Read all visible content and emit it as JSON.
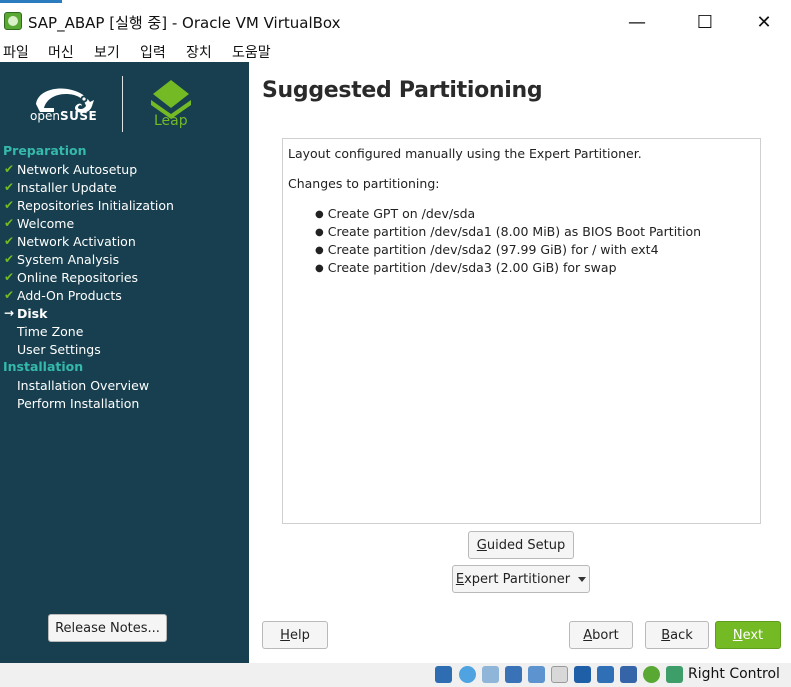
{
  "window": {
    "title": "SAP_ABAP [실행 중] - Oracle VM VirtualBox",
    "minimize_glyph": "—",
    "maximize_glyph": "☐",
    "close_glyph": "✕"
  },
  "menubar": {
    "items": [
      "파일",
      "머신",
      "보기",
      "입력",
      "장치",
      "도움말"
    ]
  },
  "sidebar": {
    "logo": {
      "brand_prefix": "open",
      "brand_suffix": "SUSE",
      "product": "Leap"
    },
    "sections": [
      {
        "title": "Preparation",
        "steps": [
          {
            "label": "Network Autosetup",
            "state": "done"
          },
          {
            "label": "Installer Update",
            "state": "done"
          },
          {
            "label": "Repositories Initialization",
            "state": "done"
          },
          {
            "label": "Welcome",
            "state": "done"
          },
          {
            "label": "Network Activation",
            "state": "done"
          },
          {
            "label": "System Analysis",
            "state": "done"
          },
          {
            "label": "Online Repositories",
            "state": "done"
          },
          {
            "label": "Add-On Products",
            "state": "done"
          },
          {
            "label": "Disk",
            "state": "current"
          },
          {
            "label": "Time Zone",
            "state": "pending"
          },
          {
            "label": "User Settings",
            "state": "pending"
          }
        ]
      },
      {
        "title": "Installation",
        "steps": [
          {
            "label": "Installation Overview",
            "state": "pending"
          },
          {
            "label": "Perform Installation",
            "state": "pending"
          }
        ]
      }
    ],
    "done_mark": "✔",
    "current_mark": "→",
    "release_notes_label": "Release Notes..."
  },
  "main": {
    "title": "Suggested Partitioning",
    "intro": "Layout configured manually using the Expert Partitioner.",
    "changes_heading": "Changes to partitioning:",
    "changes": [
      "Create GPT on /dev/sda",
      "Create partition /dev/sda1 (8.00 MiB) as BIOS Boot Partition",
      "Create partition /dev/sda2 (97.99 GiB) for / with ext4",
      "Create partition /dev/sda3 (2.00 GiB) for swap"
    ],
    "guided_setup": {
      "mnemonic": "G",
      "rest": "uided Setup"
    },
    "expert_partitioner": {
      "mnemonic": "E",
      "rest": "xpert Partitioner"
    },
    "help": {
      "mnemonic": "H",
      "rest": "elp"
    },
    "abort": {
      "mnemonic": "A",
      "rest": "bort"
    },
    "back": {
      "mnemonic": "B",
      "rest": "ack"
    },
    "next": {
      "mnemonic": "N",
      "rest": "ext"
    }
  },
  "statusbar": {
    "host_key": "Right Control",
    "icons": [
      "hard-disk-icon",
      "optical-drive-icon",
      "audio-icon",
      "network-icon",
      "usb-icon",
      "shared-folders-icon",
      "display-icon",
      "video-capture-icon",
      "virtualization-icon",
      "mouse-integration-icon",
      "keyboard-capture-icon"
    ]
  },
  "colors": {
    "sidebar_bg": "#173f4f",
    "section_heading": "#35b9ab",
    "check_green": "#73ba25",
    "next_button": "#73ba25",
    "virtualbox_accent": "#2b7bbf"
  }
}
